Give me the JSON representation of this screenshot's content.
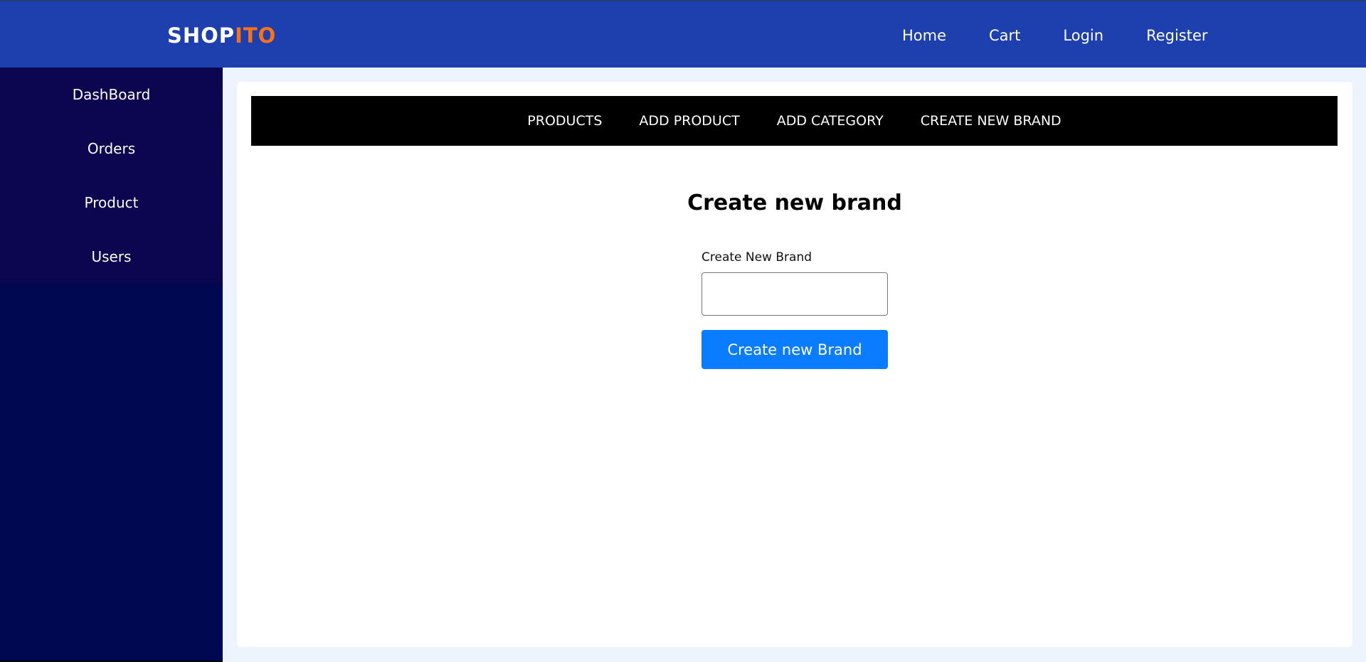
{
  "header": {
    "logo_main": "SHOP",
    "logo_accent": "ITO",
    "nav": [
      "Home",
      "Cart",
      "Login",
      "Register"
    ]
  },
  "sidebar": {
    "items": [
      "DashBoard",
      "Orders",
      "Product",
      "Users"
    ]
  },
  "admin_nav": {
    "items": [
      "PRODUCTS",
      "ADD PRODUCT",
      "ADD CATEGORY",
      "CREATE NEW BRAND"
    ]
  },
  "form": {
    "title": "Create new brand",
    "label": "Create New Brand",
    "input_value": "",
    "button_label": "Create new Brand"
  },
  "colors": {
    "header_bg": "#1e40af",
    "logo_accent": "#f97316",
    "sidebar_bg": "#000852",
    "button_bg": "#0a7cff"
  }
}
